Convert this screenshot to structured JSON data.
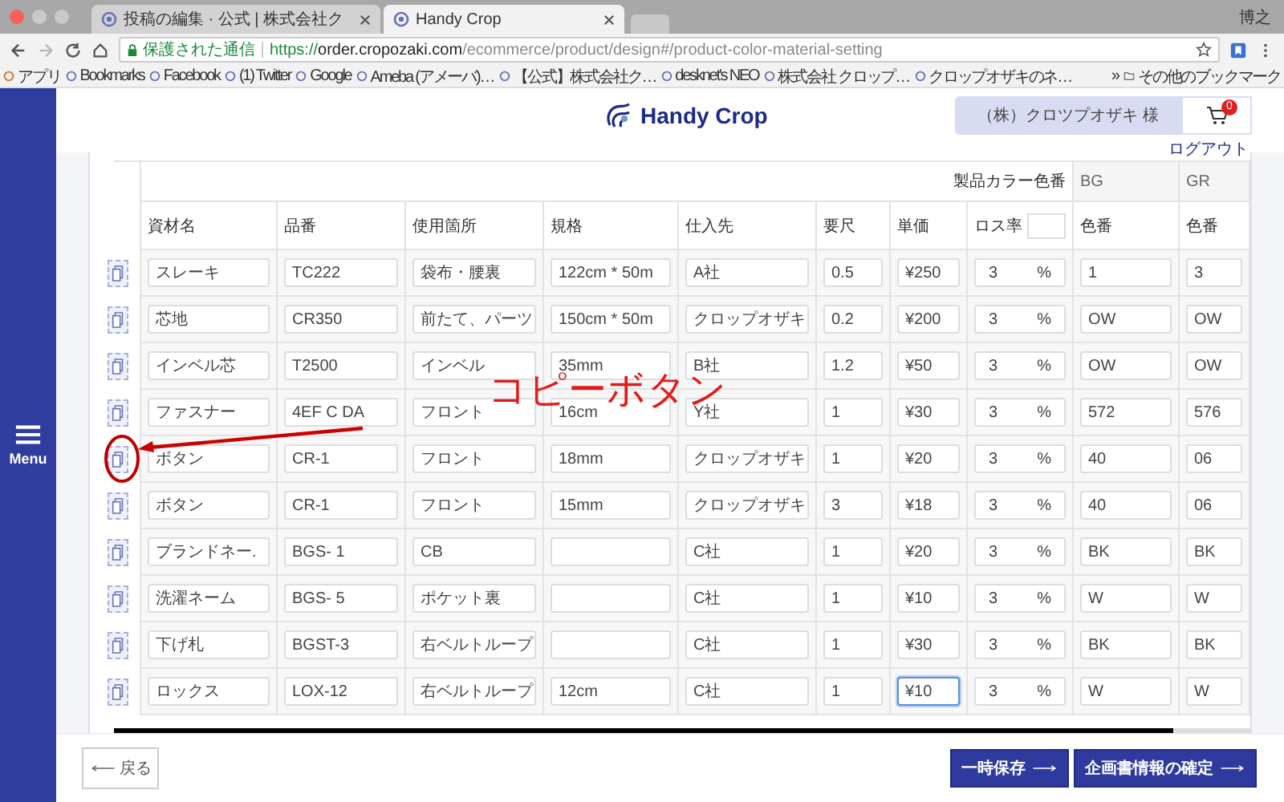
{
  "browser": {
    "tabs": [
      {
        "title": "投稿の編集 · 公式 | 株式会社ク",
        "selected": false
      },
      {
        "title": "Handy Crop",
        "selected": true
      }
    ],
    "profile": "博之",
    "secure_label": "保護された通信",
    "url_scheme": "https://",
    "url_host": "order.cropozaki.com",
    "url_path": "/ecommerce/product/design#/product-color-material-setting",
    "bookmarks": [
      "アプリ",
      "Bookmarks",
      "Facebook",
      "(1) Twitter",
      "Google",
      "Ameba (アメーバ)…",
      "【公式】株式会社ク…",
      "desknet's NEO",
      "株式会社 クロップ…",
      "クロップオザキのネ…"
    ],
    "bookmarks_more": "»",
    "other_bookmarks": "その他のブックマーク"
  },
  "sidebar": {
    "menu_label": "Menu"
  },
  "header": {
    "logo": "Handy Crop",
    "user": "（株）クロツプオザキ 様",
    "cart_count": "0",
    "logout": "ログアウト"
  },
  "table": {
    "group_header": "製品カラー色番",
    "color_columns": [
      "BG",
      "GR"
    ],
    "columns": [
      "資材名",
      "品番",
      "使用箇所",
      "規格",
      "仕入先",
      "要尺",
      "単価",
      "ロス率"
    ],
    "color_subheaders": [
      "色番",
      "色番"
    ],
    "rows": [
      {
        "name": "スレーキ",
        "code": "TC222",
        "place": "袋布・腰裏",
        "size": "122cm * 50m",
        "supplier": "A社",
        "length": "0.5",
        "price": "¥250",
        "loss": "3",
        "unit": "%",
        "colors": [
          "1",
          "3"
        ],
        "price_focused": false
      },
      {
        "name": "芯地",
        "code": "CR350",
        "place": "前たて、パーツ",
        "size": "150cm * 50m",
        "supplier": "クロップオザキ",
        "length": "0.2",
        "price": "¥200",
        "loss": "3",
        "unit": "%",
        "colors": [
          "OW",
          "OW"
        ],
        "price_focused": false
      },
      {
        "name": "インベル芯",
        "code": "T2500",
        "place": "インベル",
        "size": "35mm",
        "supplier": "B社",
        "length": "1.2",
        "price": "¥50",
        "loss": "3",
        "unit": "%",
        "colors": [
          "OW",
          "OW"
        ],
        "price_focused": false
      },
      {
        "name": "ファスナー",
        "code": "4EF C DA",
        "place": "フロント",
        "size": "16cm",
        "supplier": "Y社",
        "length": "1",
        "price": "¥30",
        "loss": "3",
        "unit": "%",
        "colors": [
          "572",
          "576"
        ],
        "price_focused": false
      },
      {
        "name": "ボタン",
        "code": "CR-1",
        "place": "フロント",
        "size": "18mm",
        "supplier": "クロップオザキ",
        "length": "1",
        "price": "¥20",
        "loss": "3",
        "unit": "%",
        "colors": [
          "40",
          "06"
        ],
        "price_focused": false
      },
      {
        "name": "ボタン",
        "code": "CR-1",
        "place": "フロント",
        "size": "15mm",
        "supplier": "クロップオザキ",
        "length": "3",
        "price": "¥18",
        "loss": "3",
        "unit": "%",
        "colors": [
          "40",
          "06"
        ],
        "price_focused": false
      },
      {
        "name": "ブランドネー.",
        "code": "BGS- 1",
        "place": "CB",
        "size": "",
        "supplier": "C社",
        "length": "1",
        "price": "¥20",
        "loss": "3",
        "unit": "%",
        "colors": [
          "BK",
          "BK"
        ],
        "price_focused": false
      },
      {
        "name": "洗濯ネーム",
        "code": "BGS- 5",
        "place": "ポケット裏",
        "size": "",
        "supplier": "C社",
        "length": "1",
        "price": "¥10",
        "loss": "3",
        "unit": "%",
        "colors": [
          "W",
          "W"
        ],
        "price_focused": false
      },
      {
        "name": "下げ札",
        "code": "BGST-3",
        "place": "右ベルトループ",
        "size": "",
        "supplier": "C社",
        "length": "1",
        "price": "¥30",
        "loss": "3",
        "unit": "%",
        "colors": [
          "BK",
          "BK"
        ],
        "price_focused": false
      },
      {
        "name": "ロックス",
        "code": "LOX-12",
        "place": "右ベルトループ",
        "size": "12cm",
        "supplier": "C社",
        "length": "1",
        "price": "¥10",
        "loss": "3",
        "unit": "%",
        "colors": [
          "W",
          "W"
        ],
        "price_focused": true
      }
    ]
  },
  "annotation": {
    "text": "コピーボタン"
  },
  "footer": {
    "back": "戻る",
    "buttons": [
      "一時保存",
      "企画書情報の確定"
    ]
  }
}
